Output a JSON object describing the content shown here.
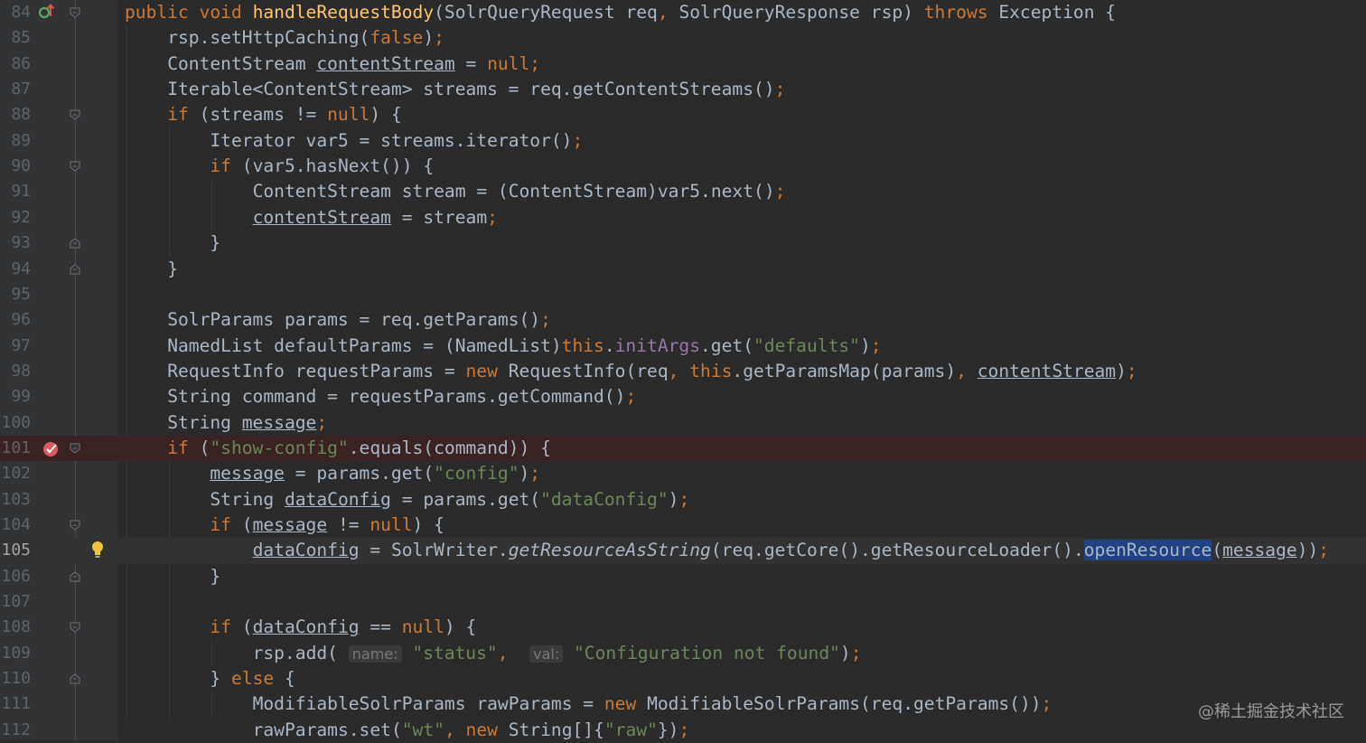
{
  "editor": {
    "lines": [
      {
        "n": "84",
        "indent": 0,
        "gutter": "override",
        "fold": "open",
        "tokens": [
          [
            "kw",
            "public "
          ],
          [
            "kw",
            "void "
          ],
          [
            "fn",
            "handleRequestBody"
          ],
          [
            "p",
            "(SolrQueryRequest req"
          ],
          [
            "kw",
            ", "
          ],
          [
            "p",
            "SolrQueryResponse rsp) "
          ],
          [
            "kw",
            "throws "
          ],
          [
            "p",
            "Exception {"
          ]
        ]
      },
      {
        "n": "85",
        "indent": 1,
        "tokens": [
          [
            "p",
            "rsp.setHttpCaching("
          ],
          [
            "kw",
            "false"
          ],
          [
            "p",
            ")"
          ],
          [
            "kw",
            ";"
          ]
        ]
      },
      {
        "n": "86",
        "indent": 1,
        "tokens": [
          [
            "p",
            "ContentStream "
          ],
          [
            "ul",
            "contentStream"
          ],
          [
            "p",
            " = "
          ],
          [
            "kw",
            "null;"
          ]
        ]
      },
      {
        "n": "87",
        "indent": 1,
        "tokens": [
          [
            "p",
            "Iterable<ContentStream> streams = req.getContentStreams()"
          ],
          [
            "kw",
            ";"
          ]
        ]
      },
      {
        "n": "88",
        "indent": 1,
        "fold": "open",
        "tokens": [
          [
            "kw",
            "if "
          ],
          [
            "p",
            "(streams != "
          ],
          [
            "kw",
            "null"
          ],
          [
            "p",
            ") {"
          ]
        ]
      },
      {
        "n": "89",
        "indent": 2,
        "tokens": [
          [
            "p",
            "Iterator var5 = streams.iterator()"
          ],
          [
            "kw",
            ";"
          ]
        ]
      },
      {
        "n": "90",
        "indent": 2,
        "fold": "open",
        "tokens": [
          [
            "kw",
            "if "
          ],
          [
            "p",
            "(var5.hasNext()) {"
          ]
        ]
      },
      {
        "n": "91",
        "indent": 3,
        "tokens": [
          [
            "p",
            "ContentStream stream = (ContentStream)var5.next()"
          ],
          [
            "kw",
            ";"
          ]
        ]
      },
      {
        "n": "92",
        "indent": 3,
        "tokens": [
          [
            "ul",
            "contentStream"
          ],
          [
            "p",
            " = stream"
          ],
          [
            "kw",
            ";"
          ]
        ]
      },
      {
        "n": "93",
        "indent": 2,
        "fold": "close",
        "tokens": [
          [
            "p",
            "}"
          ]
        ]
      },
      {
        "n": "94",
        "indent": 1,
        "fold": "close",
        "tokens": [
          [
            "p",
            "}"
          ]
        ]
      },
      {
        "n": "95",
        "indent": 0,
        "tokens": []
      },
      {
        "n": "96",
        "indent": 1,
        "tokens": [
          [
            "p",
            "SolrParams params = req.getParams()"
          ],
          [
            "kw",
            ";"
          ]
        ]
      },
      {
        "n": "97",
        "indent": 1,
        "tokens": [
          [
            "p",
            "NamedList defaultParams = (NamedList)"
          ],
          [
            "kw",
            "this"
          ],
          [
            "p",
            "."
          ],
          [
            "field",
            "initArgs"
          ],
          [
            "p",
            ".get("
          ],
          [
            "str",
            "\"defaults\""
          ],
          [
            "p",
            ")"
          ],
          [
            "kw",
            ";"
          ]
        ]
      },
      {
        "n": "98",
        "indent": 1,
        "tokens": [
          [
            "p",
            "RequestInfo requestParams = "
          ],
          [
            "kw",
            "new "
          ],
          [
            "p",
            "RequestInfo(req"
          ],
          [
            "kw",
            ", this"
          ],
          [
            "p",
            ".getParamsMap(params)"
          ],
          [
            "kw",
            ", "
          ],
          [
            "ul",
            "contentStream"
          ],
          [
            "p",
            ")"
          ],
          [
            "kw",
            ";"
          ]
        ]
      },
      {
        "n": "99",
        "indent": 1,
        "tokens": [
          [
            "p",
            "String command = requestParams.getCommand()"
          ],
          [
            "kw",
            ";"
          ]
        ]
      },
      {
        "n": "100",
        "indent": 1,
        "tokens": [
          [
            "p",
            "String "
          ],
          [
            "ul",
            "message"
          ],
          [
            "kw",
            ";"
          ]
        ]
      },
      {
        "n": "101",
        "indent": 1,
        "gutter": "breakpoint",
        "fold": "open",
        "bp": true,
        "tokens": [
          [
            "kw",
            "if "
          ],
          [
            "p",
            "("
          ],
          [
            "str",
            "\"show-config\""
          ],
          [
            "p",
            ".equals(command)) {"
          ]
        ]
      },
      {
        "n": "102",
        "indent": 2,
        "tokens": [
          [
            "ul",
            "message"
          ],
          [
            "p",
            " = params.get("
          ],
          [
            "str",
            "\"config\""
          ],
          [
            "p",
            ")"
          ],
          [
            "kw",
            ";"
          ]
        ]
      },
      {
        "n": "103",
        "indent": 2,
        "tokens": [
          [
            "p",
            "String "
          ],
          [
            "ul",
            "dataConfig"
          ],
          [
            "p",
            " = params.get("
          ],
          [
            "str",
            "\"dataConfig\""
          ],
          [
            "p",
            ")"
          ],
          [
            "kw",
            ";"
          ]
        ]
      },
      {
        "n": "104",
        "indent": 2,
        "fold": "open",
        "tokens": [
          [
            "kw",
            "if "
          ],
          [
            "p",
            "("
          ],
          [
            "ul",
            "message"
          ],
          [
            "p",
            " != "
          ],
          [
            "kw",
            "null"
          ],
          [
            "p",
            ") {"
          ]
        ]
      },
      {
        "n": "105",
        "indent": 3,
        "gutter": "bulb",
        "caret": true,
        "tokens": [
          [
            "ul",
            "dataConfig"
          ],
          [
            "p",
            " = SolrWriter."
          ],
          [
            "it",
            "getResourceAsString"
          ],
          [
            "p",
            "(req.getCore().getResourceLoader()."
          ],
          [
            "sel",
            "openResource"
          ],
          [
            "p",
            "("
          ],
          [
            "ul",
            "message"
          ],
          [
            "p",
            "))"
          ],
          [
            "kw",
            ";"
          ]
        ]
      },
      {
        "n": "106",
        "indent": 2,
        "fold": "close",
        "tokens": [
          [
            "p",
            "}"
          ]
        ]
      },
      {
        "n": "107",
        "indent": 0,
        "tokens": []
      },
      {
        "n": "108",
        "indent": 2,
        "fold": "open",
        "tokens": [
          [
            "kw",
            "if "
          ],
          [
            "p",
            "("
          ],
          [
            "ul",
            "dataConfig"
          ],
          [
            "p",
            " == "
          ],
          [
            "kw",
            "null"
          ],
          [
            "p",
            ") {"
          ]
        ]
      },
      {
        "n": "109",
        "indent": 3,
        "tokens": [
          [
            "p",
            "rsp.add( "
          ],
          [
            "hint",
            "name:"
          ],
          [
            "p",
            " "
          ],
          [
            "str",
            "\"status\""
          ],
          [
            "kw",
            ", "
          ],
          [
            "p",
            " "
          ],
          [
            "hint",
            "val:"
          ],
          [
            "p",
            " "
          ],
          [
            "str",
            "\"Configuration not found\""
          ],
          [
            "p",
            ")"
          ],
          [
            "kw",
            ";"
          ]
        ]
      },
      {
        "n": "110",
        "indent": 2,
        "fold": "close",
        "tokens": [
          [
            "p",
            "} "
          ],
          [
            "kw",
            "else "
          ],
          [
            "p",
            "{"
          ]
        ]
      },
      {
        "n": "111",
        "indent": 3,
        "tokens": [
          [
            "p",
            "ModifiableSolrParams rawParams = "
          ],
          [
            "kw",
            "new "
          ],
          [
            "p",
            "ModifiableSolrParams(req.getParams())"
          ],
          [
            "kw",
            ";"
          ]
        ]
      },
      {
        "n": "112",
        "indent": 3,
        "tokens": [
          [
            "p",
            "rawParams.set("
          ],
          [
            "str",
            "\"wt\""
          ],
          [
            "kw",
            ", new "
          ],
          [
            "p",
            "String[]{"
          ],
          [
            "str",
            "\"raw\""
          ],
          [
            "p",
            "})"
          ],
          [
            "kw",
            ";"
          ]
        ]
      }
    ]
  },
  "watermark": "@稀土掘金技术社区",
  "colors": {
    "background": "#2b2b2b",
    "gutter": "#313335",
    "keyword": "#cc7832",
    "function": "#ffc66d",
    "string": "#6a8759",
    "field": "#9876aa",
    "plain": "#a9b7c6",
    "breakpoint_line": "#3a2323",
    "selection": "#214283"
  },
  "icons": {
    "override": "override-up-arrow-icon",
    "breakpoint": "breakpoint-icon",
    "bulb": "lightbulb-icon",
    "fold": "fold-marker-icon"
  }
}
